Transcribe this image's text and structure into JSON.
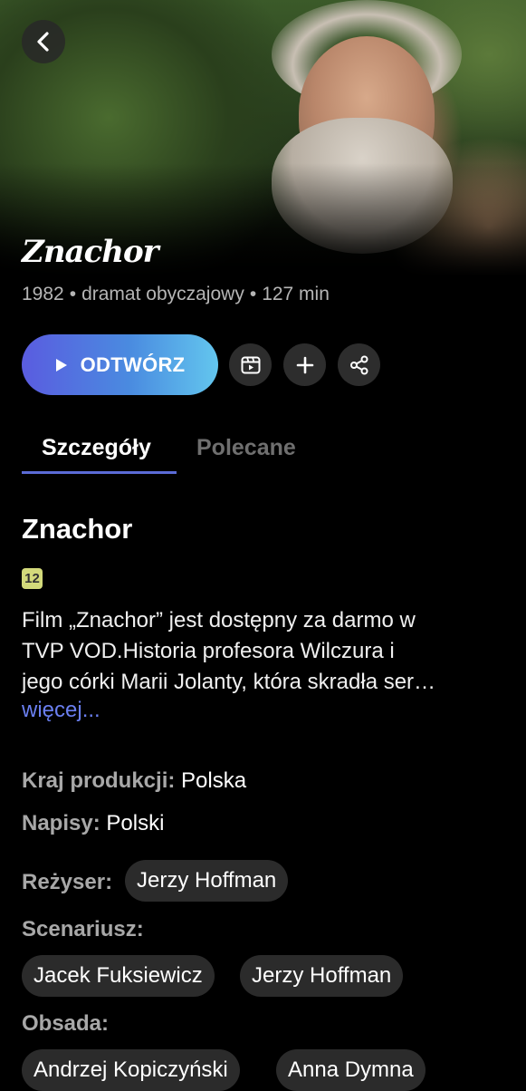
{
  "header": {
    "back_icon": "chevron-left-icon",
    "title_logo": "Znachor"
  },
  "meta": {
    "year": "1982",
    "genre": "dramat obyczajowy",
    "duration": "127 min",
    "separator": "•"
  },
  "actions": {
    "play_label": "ODTWÓRZ",
    "play_icon": "play-icon",
    "trailer_icon": "film-icon",
    "add_icon": "plus-icon",
    "share_icon": "share-icon"
  },
  "tabs": [
    {
      "label": "Szczegóły",
      "active": true
    },
    {
      "label": "Polecane",
      "active": false
    }
  ],
  "details": {
    "title": "Znachor",
    "age_rating": "12",
    "description_lines": [
      "Film „Znachor” jest dostępny za darmo w",
      "TVP VOD.Historia profesora Wilczura i",
      "jego córki Marii Jolanty, która skradła ser…"
    ],
    "more_label": "więcej...",
    "country_label": "Kraj produkcji:",
    "country_value": "Polska",
    "subtitles_label": "Napisy:",
    "subtitles_value": "Polski",
    "director_label": "Reżyser:",
    "director": "Jerzy Hoffman",
    "screenplay_label": "Scenariusz:",
    "screenwriters": [
      "Jacek Fuksiewicz",
      "Jerzy Hoffman"
    ],
    "cast_label": "Obsada:",
    "cast": [
      "Andrzej Kopiczyński",
      "Anna Dymna"
    ]
  },
  "colors": {
    "accent": "#5b6bd6",
    "link": "#6a7ff0",
    "play_gradient_start": "#5a5ce0",
    "play_gradient_end": "#63c6ee",
    "age_badge": "#d3da7b"
  }
}
